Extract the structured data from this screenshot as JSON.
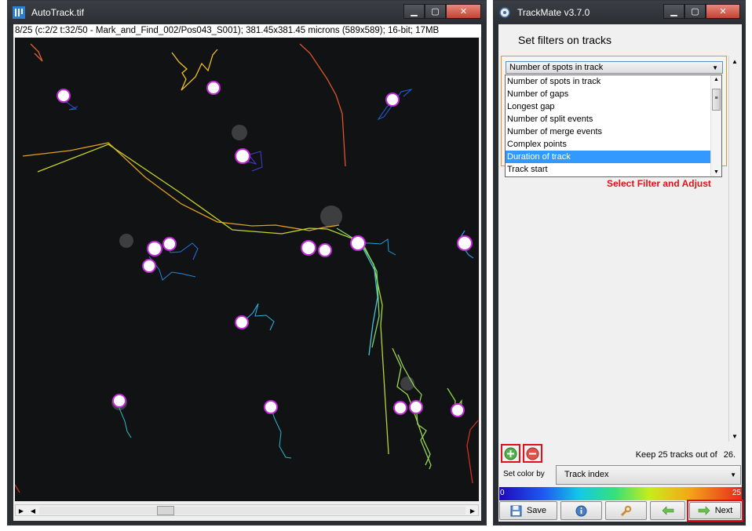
{
  "left_window": {
    "title": "AutoTrack.tif",
    "info_line": "8/25 (c:2/2 t:32/50 - Mark_and_Find_002/Pos043_S001); 381.45x381.45 microns (589x589); 16-bit; 17MB"
  },
  "right_window": {
    "title": "TrackMate v3.7.0",
    "heading": "Set filters on tracks",
    "filter_combo": "Number of spots in track",
    "dropdown_options": [
      "Number of spots in track",
      "Number of gaps",
      "Longest gap",
      "Number of split events",
      "Number of merge events",
      "Complex points",
      "Duration of track",
      "Track start"
    ],
    "selected_option": "Duration of track",
    "annotation": "Select Filter and Adjust",
    "keep_text": "Keep 25 tracks out of",
    "keep_total": "26.",
    "color_by_label": "Set color by",
    "color_by_value": "Track index",
    "lut_min": "0",
    "lut_max": "25",
    "save_label": "Save",
    "next_label": "Next"
  },
  "colors": {
    "annotation_red": "#e1111a",
    "selection_blue": "#3399ff",
    "panel_border": "#e8922a"
  },
  "icons": [
    "fiji-icon",
    "trackmate-icon",
    "minimize-icon",
    "maximize-icon",
    "close-icon",
    "add-filter-icon",
    "remove-filter-icon",
    "save-icon",
    "info-icon",
    "wrench-icon",
    "back-arrow-icon",
    "next-arrow-icon"
  ]
}
